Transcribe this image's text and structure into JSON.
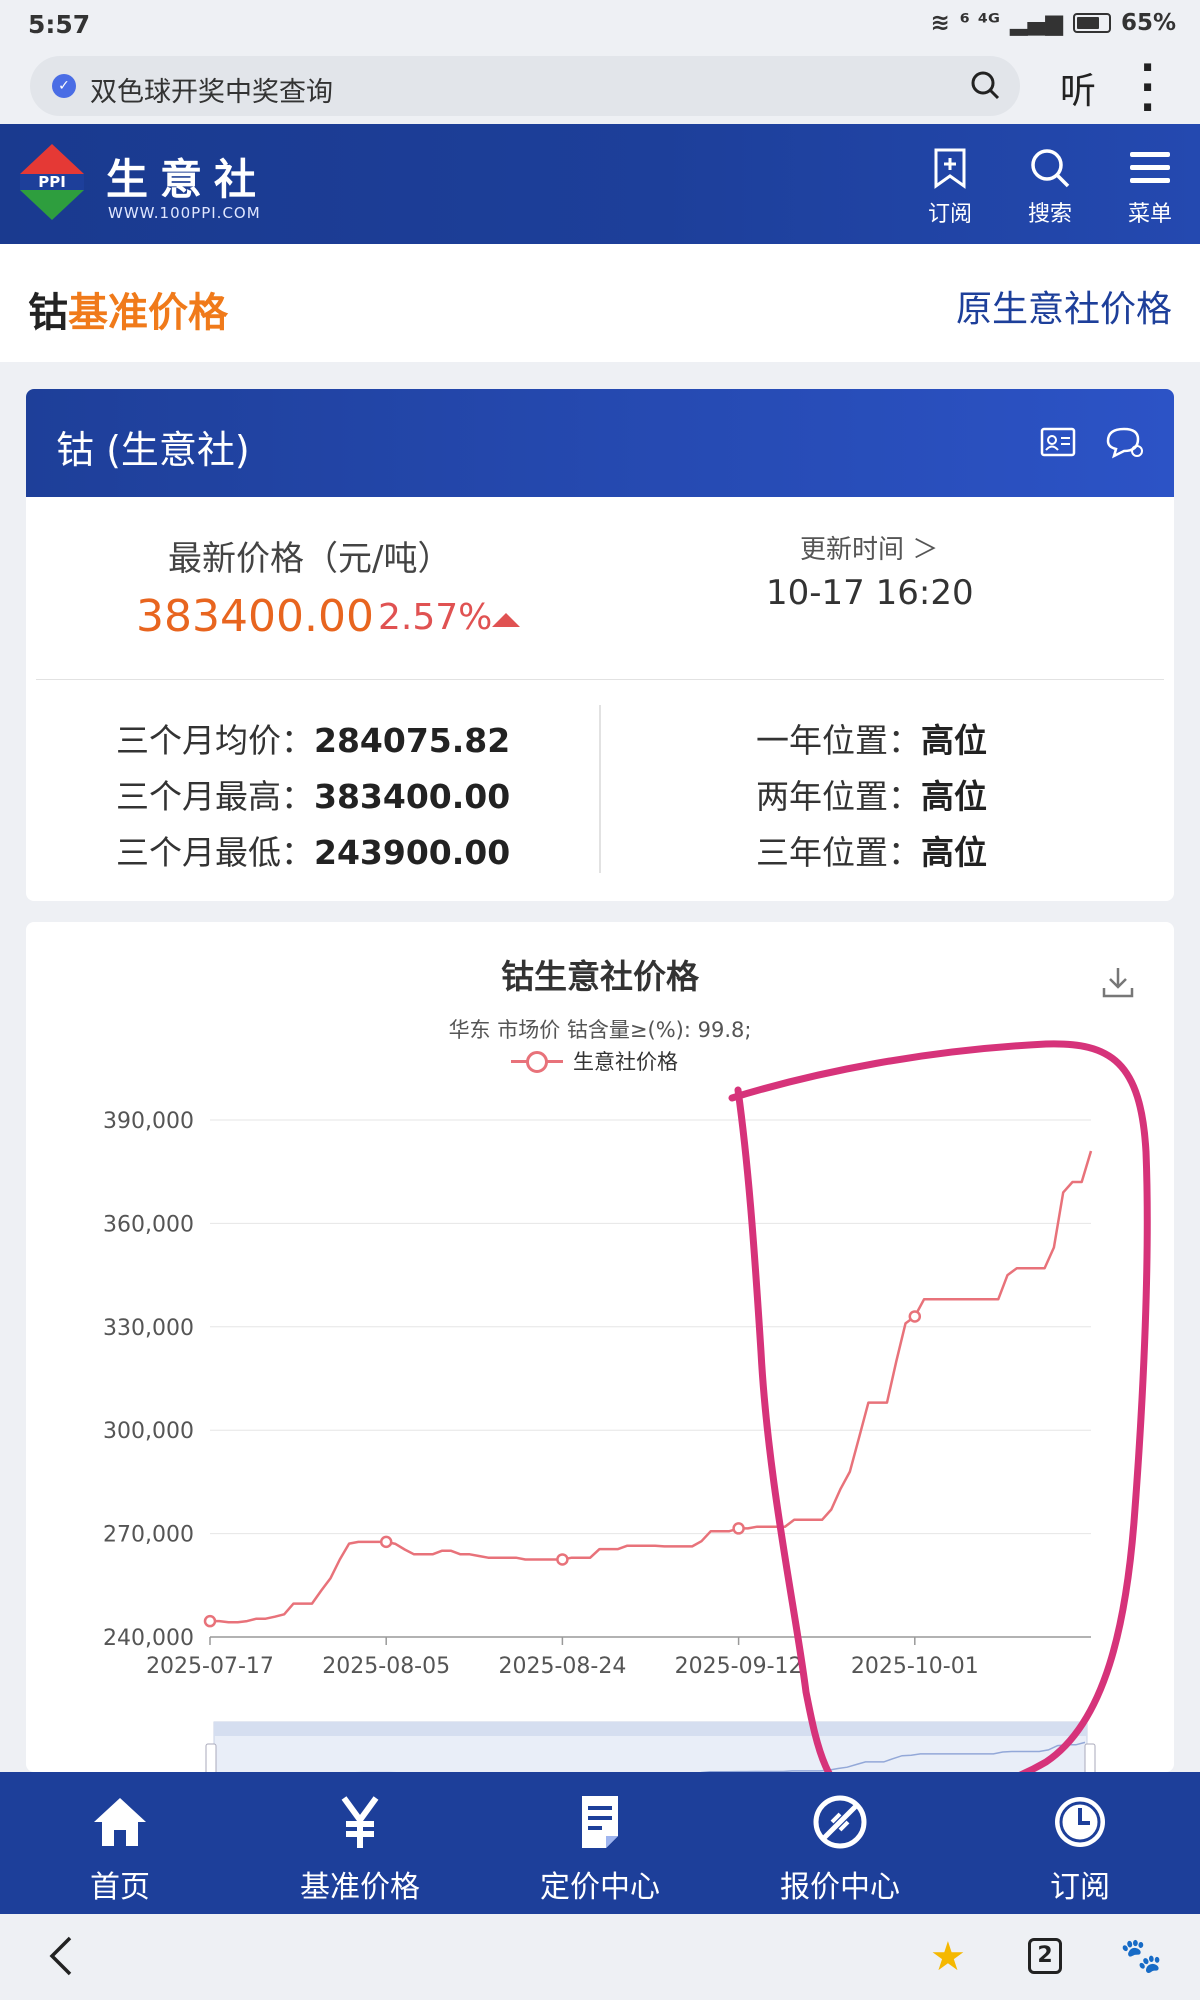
{
  "status": {
    "time": "5:57",
    "network": "⁶ ⁴ᴳ",
    "battery": "65%"
  },
  "browser": {
    "query": "双色球开奖中奖查询",
    "listen_label": "听",
    "more_label": "⋮"
  },
  "site": {
    "brand": "生意社",
    "url": "WWW.100PPI.COM",
    "logo_text": "PPI",
    "nav": [
      {
        "label": "订阅",
        "icon": "bookmark-icon"
      },
      {
        "label": "搜索",
        "icon": "search-icon"
      },
      {
        "label": "菜单",
        "icon": "menu-icon"
      }
    ]
  },
  "title": {
    "commodity": "钴",
    "suffix": "基准价格",
    "link": "原生意社价格",
    "accent_color": "#f07a1a"
  },
  "card": {
    "name": "钴 (生意社)",
    "price_label": "最新价格（元/吨）",
    "price": "383400.00",
    "change": "2.57%",
    "updated_label": "更新时间 ＞",
    "updated_time": "10-17 16:20",
    "stats_left": [
      {
        "label": "三个月均价：",
        "value": "284075.82"
      },
      {
        "label": "三个月最高：",
        "value": "383400.00"
      },
      {
        "label": "三个月最低：",
        "value": "243900.00"
      }
    ],
    "stats_right": [
      {
        "label": "一年位置：",
        "value": "高位"
      },
      {
        "label": "两年位置：",
        "value": "高位"
      },
      {
        "label": "三年位置：",
        "value": "高位"
      }
    ]
  },
  "chart_data": {
    "type": "line",
    "title": "钴生意社价格",
    "subtitle": "华东 市场价 钴含量≥(%): 99.8;",
    "series": [
      {
        "name": "生意社价格",
        "color": "#e8727a",
        "values": [
          244600,
          244600,
          244300,
          244300,
          244600,
          245300,
          245300,
          245900,
          246600,
          249700,
          249700,
          249700,
          253500,
          257100,
          262500,
          267100,
          267600,
          267600,
          267600,
          267600,
          267000,
          265400,
          264000,
          264000,
          264000,
          265000,
          265000,
          264000,
          264000,
          263500,
          263000,
          263000,
          263000,
          263000,
          262500,
          262500,
          262500,
          262500,
          262500,
          263000,
          263000,
          263000,
          265500,
          265500,
          265500,
          266500,
          266500,
          266500,
          266500,
          266300,
          266300,
          266300,
          266300,
          267800,
          270700,
          270700,
          270700,
          271500,
          271500,
          272000,
          272000,
          272000,
          272000,
          274000,
          274000,
          274000,
          274000,
          277000,
          283000,
          288000,
          298000,
          308000,
          308000,
          308000,
          320000,
          331000,
          333000,
          338000,
          338000,
          338000,
          338000,
          338000,
          338000,
          338000,
          338000,
          338000,
          345000,
          347000,
          347000,
          347000,
          347000,
          353000,
          369000,
          372000,
          372000,
          381000
        ]
      }
    ],
    "x_start": "2025-07-17",
    "x_ticks": [
      "2025-07-17",
      "2025-08-05",
      "2025-08-24",
      "2025-09-12",
      "2025-10-01"
    ],
    "y_ticks": [
      "240,000",
      "270,000",
      "300,000",
      "330,000",
      "360,000",
      "390,000"
    ],
    "ylim": [
      240000,
      390000
    ],
    "grid": true,
    "legend": "top-center"
  },
  "tabs": [
    {
      "label": "首页",
      "icon": "home-icon"
    },
    {
      "label": "基准价格",
      "icon": "yen-icon"
    },
    {
      "label": "定价中心",
      "icon": "document-icon"
    },
    {
      "label": "报价中心",
      "icon": "quote-icon"
    },
    {
      "label": "订阅",
      "icon": "clock-icon"
    }
  ],
  "sysnav": {
    "tab_count": "2"
  }
}
